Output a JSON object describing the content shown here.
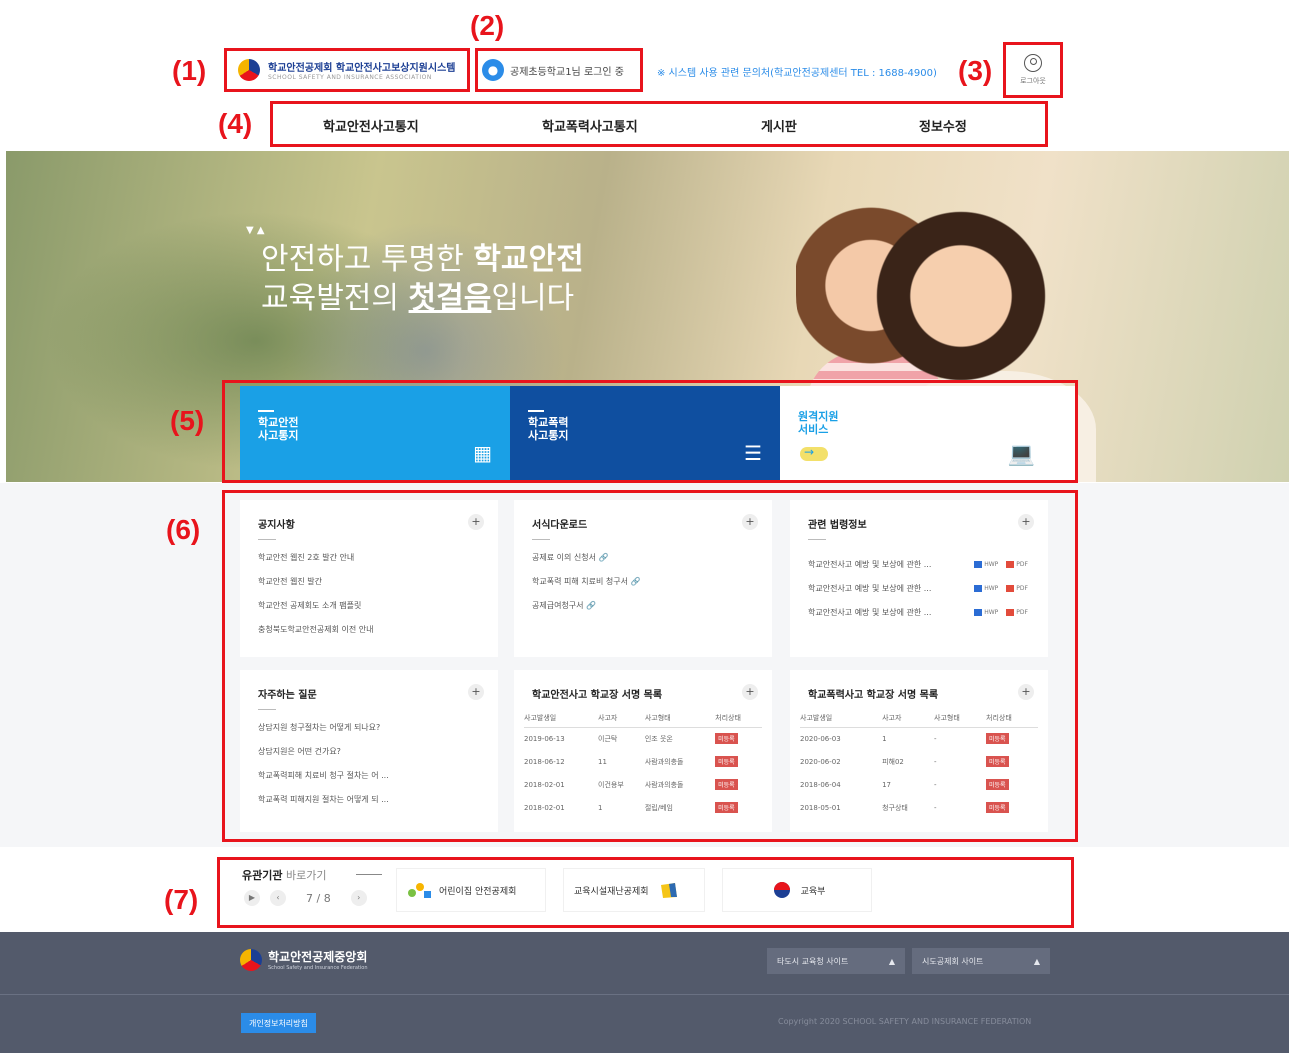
{
  "annotations": [
    "(1)",
    "(2)",
    "(3)",
    "(4)",
    "(5)",
    "(6)",
    "(7)"
  ],
  "header": {
    "logo_title": "학교안전공제회 학교안전사고보상지원시스템",
    "logo_sub": "SCHOOL SAFETY AND INSURANCE ASSOCIATION",
    "login_status": "공제초등학교1님 로그인 중",
    "notice": "※ 시스템 사용 관련 문의처(학교안전공제센터 TEL : 1688-4900)",
    "logout_label": "로그아웃"
  },
  "gnb": [
    "학교안전사고통지",
    "학교폭력사고통지",
    "게시판",
    "정보수정"
  ],
  "hero": {
    "line1_normal": "안전하고 투명한 ",
    "line1_bold": "학교안전",
    "line2_normal_a": "교육발전의 ",
    "line2_bold": "첫걸음",
    "line2_normal_b": "입니다"
  },
  "tiles": [
    {
      "label": "학교안전\n사고통지",
      "icon": "calendar-icon"
    },
    {
      "label": "학교폭력\n사고통지",
      "icon": "person-list-icon"
    },
    {
      "label": "원격지원\n서비스",
      "icon": "laptop-support-icon"
    }
  ],
  "notice_board": {
    "title": "공지사항",
    "items": [
      "학교안전 웹진 2호 발간 안내",
      "학교안전 웹진 발간",
      "학교안전 공제회도 소개 팸플릿",
      "충청북도학교안전공제회 이전 안내"
    ]
  },
  "download_board": {
    "title": "서식다운로드",
    "items": [
      "공제료 이의 신청서 🔗",
      "학교폭력 피해 치료비 청구서 🔗",
      "공제급여청구서 🔗"
    ]
  },
  "law_board": {
    "title": "관련 법령정보",
    "items": [
      "학교안전사고 예방 및 보상에 관한 ...",
      "학교안전사고 예방 및 보상에 관한 ...",
      "학교안전사고 예방 및 보상에 관한 ..."
    ],
    "hwp": "HWP",
    "pdf": "PDF"
  },
  "faq_board": {
    "title": "자주하는 질문",
    "items": [
      "상담지원 청구절차는 어떻게 되나요?",
      "상담지원은 어떤 건가요?",
      "학교폭력피해 치료비 청구 절차는 어 ...",
      "학교폭력 피해지원 절차는 어떻게 되 ..."
    ]
  },
  "safety_table": {
    "title": "학교안전사고 학교장 서명 목록",
    "headers": [
      "사고발생일",
      "사고자",
      "사고형태",
      "처리상태"
    ],
    "rows": [
      [
        "2019-06-13",
        "이근탁",
        "인조 웃온",
        "미등록"
      ],
      [
        "2018-06-12",
        "11",
        "사람과의충돌",
        "미등록"
      ],
      [
        "2018-02-01",
        "이건용부",
        "사람과의충돌",
        "미등록"
      ],
      [
        "2018-02-01",
        "1",
        "절립/베임",
        "미등록"
      ]
    ]
  },
  "violence_table": {
    "title": "학교폭력사고 학교장 서명 목록",
    "headers": [
      "사고발생일",
      "사고자",
      "사고형태",
      "처리상태"
    ],
    "rows": [
      [
        "2020-06-03",
        "1",
        "-",
        "미등록"
      ],
      [
        "2020-06-02",
        "피해02",
        "-",
        "미등록"
      ],
      [
        "2018-06-04",
        "17",
        "-",
        "미등록"
      ],
      [
        "2018-05-01",
        "청구상태",
        "-",
        "미등록"
      ]
    ]
  },
  "related": {
    "title_bold": "유관기관",
    "title_light": " 바로가기",
    "page": "7 / 8",
    "orgs": [
      "어린이집 안전공제회",
      "교육시설재난공제회",
      "교육부"
    ]
  },
  "footer": {
    "logo_title": "학교안전공제중앙회",
    "logo_sub": "School Safety and Insurance Federation",
    "select1": "타도시 교육청 사이트",
    "select2": "시도공제회 사이트",
    "privacy": "개인정보처리방침",
    "copyright": "Copyright 2020 SCHOOL SAFETY AND INSURANCE FEDERATION"
  }
}
